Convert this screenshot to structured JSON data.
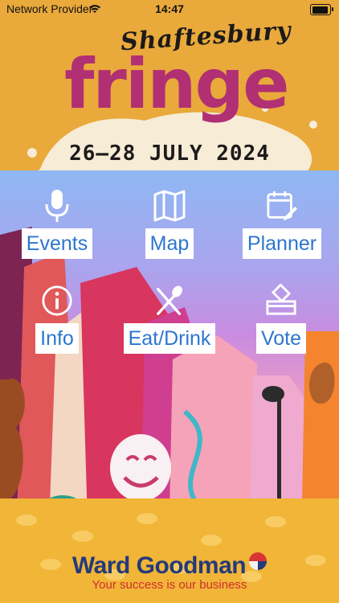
{
  "status_bar": {
    "carrier": "Network Provider",
    "time": "14:47"
  },
  "header": {
    "title_top": "Shaftesbury",
    "title_main": "fringe",
    "dates": "26–28 JULY 2024"
  },
  "nav": [
    {
      "label": "Events",
      "icon": "microphone-icon"
    },
    {
      "label": "Map",
      "icon": "map-icon"
    },
    {
      "label": "Planner",
      "icon": "calendar-edit-icon"
    },
    {
      "label": "Info",
      "icon": "info-icon"
    },
    {
      "label": "Eat/Drink",
      "icon": "fork-spoon-icon"
    },
    {
      "label": "Vote",
      "icon": "ballot-box-icon"
    }
  ],
  "sponsor": {
    "name": "Ward Goodman",
    "tagline": "Your success is our business"
  },
  "colors": {
    "header_bg": "#e9a93b",
    "fringe_pink": "#b12f73",
    "label_blue": "#2d76cf",
    "sponsor_navy": "#243a7a",
    "sponsor_red": "#cf2e2e"
  }
}
